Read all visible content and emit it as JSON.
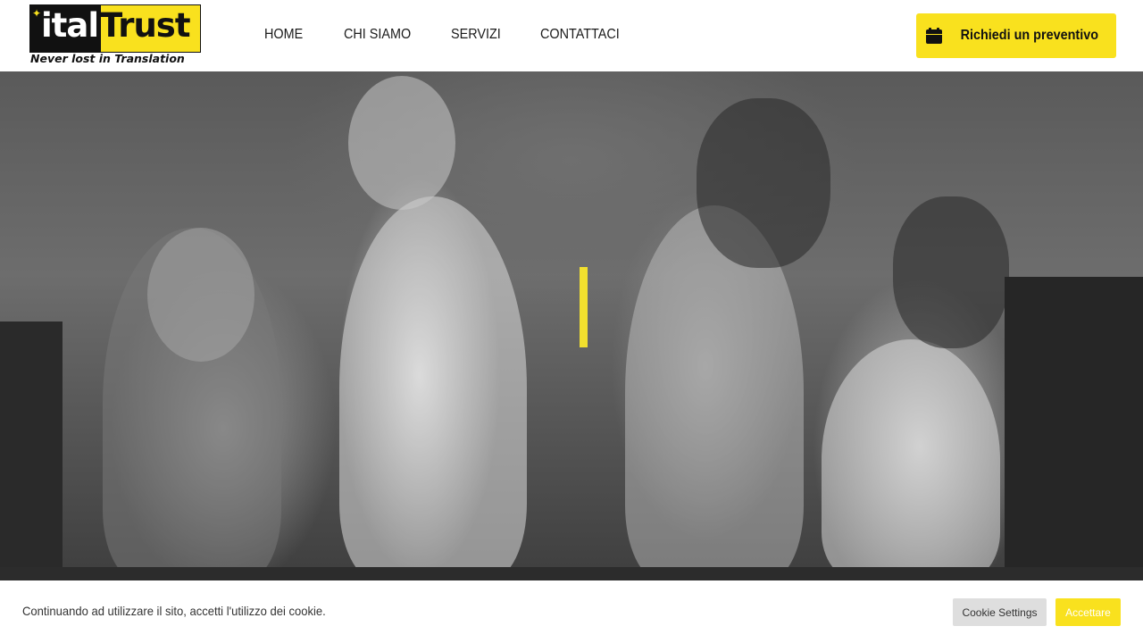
{
  "brand": {
    "logo_part1": "ital",
    "logo_part2": "Trust",
    "tagline": "Never lost in Translation",
    "accent_color": "#f9e11e"
  },
  "nav": {
    "items": [
      {
        "label": "HOME"
      },
      {
        "label": "CHI SIAMO"
      },
      {
        "label": "SERVIZI"
      },
      {
        "label": "CONTATTACI"
      }
    ]
  },
  "cta": {
    "label": "Richiedi un preventivo",
    "icon": "calendar-icon"
  },
  "hero": {
    "image": "grayscale photo of four women working at a desk"
  },
  "cookie_bar": {
    "message": "Continuando ad utilizzare il sito, accetti l'utilizzo dei cookie.",
    "settings_label": "Cookie Settings",
    "accept_label": "Accettare"
  }
}
